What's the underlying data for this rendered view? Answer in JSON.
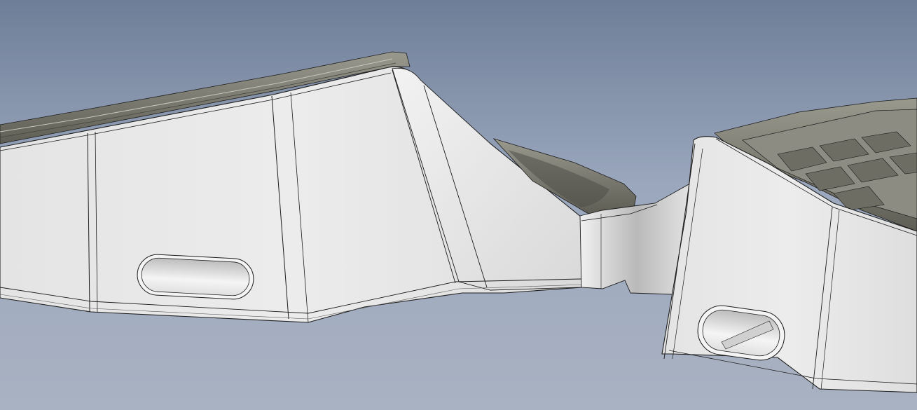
{
  "scene": {
    "background_top": "#6f7e98",
    "background_mid": "#9aa7bd",
    "background_bottom": "#a9b2c2",
    "body_color": "#e9e9e9",
    "body_shadow": "#cfcfcf",
    "tray_color": "#7c7b70",
    "tray_dark": "#5f5e55",
    "edge_color": "#1c1c1c"
  }
}
